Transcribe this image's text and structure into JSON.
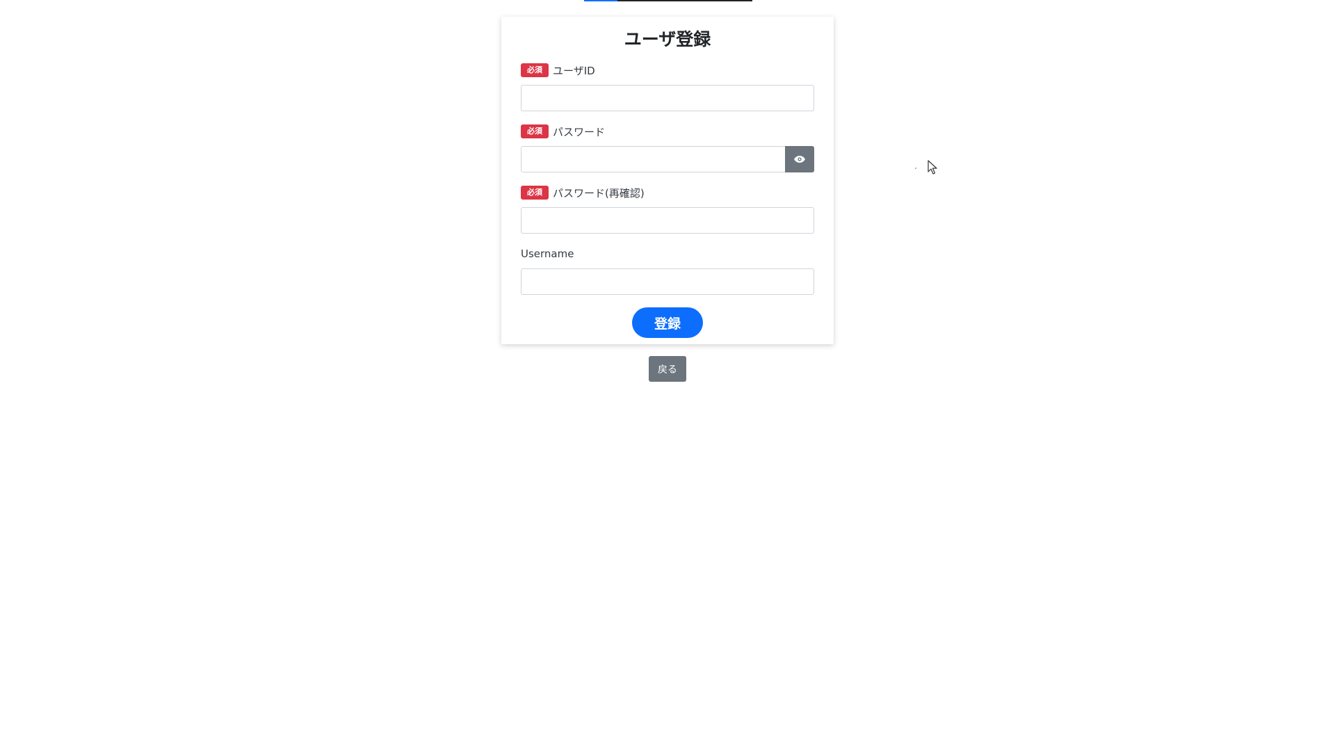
{
  "form": {
    "title": "ユーザ登録",
    "required_badge": "必須",
    "fields": [
      {
        "label": "ユーザID",
        "required": true,
        "value": "",
        "placeholder": ""
      },
      {
        "label": "パスワード",
        "required": true,
        "value": "",
        "placeholder": ""
      },
      {
        "label": "パスワード(再確認)",
        "required": true,
        "value": "",
        "placeholder": ""
      },
      {
        "label": "Username",
        "required": false,
        "value": "",
        "placeholder": ""
      }
    ],
    "submit_label": "登録"
  },
  "nav": {
    "back_label": "戻る"
  },
  "icons": {
    "password_toggle": "eye-icon",
    "pointer": "mouse-cursor-icon"
  },
  "colors": {
    "primary": "#0d6efd",
    "danger": "#dc3545",
    "secondary": "#6c757d"
  }
}
